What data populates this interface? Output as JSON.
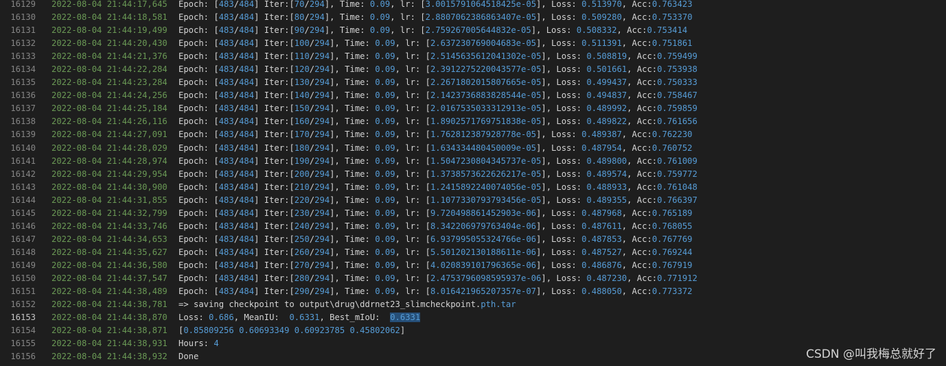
{
  "log": {
    "lines": [
      {
        "n": "16129",
        "ts": "2022-08-04 21:44:17,645",
        "msg": "Epoch: [483/484] Iter:[70/294], Time: 0.09, lr: [3.0015791064518425e-05], Loss: 0.513970, Acc:0.763423"
      },
      {
        "n": "16130",
        "ts": "2022-08-04 21:44:18,581",
        "msg": "Epoch: [483/484] Iter:[80/294], Time: 0.09, lr: [2.8807062386863407e-05], Loss: 0.509280, Acc:0.753370"
      },
      {
        "n": "16131",
        "ts": "2022-08-04 21:44:19,499",
        "msg": "Epoch: [483/484] Iter:[90/294], Time: 0.09, lr: [2.759267005644832e-05], Loss: 0.508332, Acc:0.753414"
      },
      {
        "n": "16132",
        "ts": "2022-08-04 21:44:20,430",
        "msg": "Epoch: [483/484] Iter:[100/294], Time: 0.09, lr: [2.637230769004683e-05], Loss: 0.511391, Acc:0.751861"
      },
      {
        "n": "16133",
        "ts": "2022-08-04 21:44:21,376",
        "msg": "Epoch: [483/484] Iter:[110/294], Time: 0.09, lr: [2.5145635612041302e-05], Loss: 0.508819, Acc:0.759499"
      },
      {
        "n": "16134",
        "ts": "2022-08-04 21:44:22,284",
        "msg": "Epoch: [483/484] Iter:[120/294], Time: 0.09, lr: [2.3912275220043577e-05], Loss: 0.501661, Acc:0.753938"
      },
      {
        "n": "16135",
        "ts": "2022-08-04 21:44:23,284",
        "msg": "Epoch: [483/484] Iter:[130/294], Time: 0.09, lr: [2.2671802015807665e-05], Loss: 0.499437, Acc:0.750333"
      },
      {
        "n": "16136",
        "ts": "2022-08-04 21:44:24,256",
        "msg": "Epoch: [483/484] Iter:[140/294], Time: 0.09, lr: [2.1423736883828544e-05], Loss: 0.494837, Acc:0.758467"
      },
      {
        "n": "16137",
        "ts": "2022-08-04 21:44:25,184",
        "msg": "Epoch: [483/484] Iter:[150/294], Time: 0.09, lr: [2.0167535033312913e-05], Loss: 0.489992, Acc:0.759859"
      },
      {
        "n": "16138",
        "ts": "2022-08-04 21:44:26,116",
        "msg": "Epoch: [483/484] Iter:[160/294], Time: 0.09, lr: [1.8902571769751838e-05], Loss: 0.489822, Acc:0.761656"
      },
      {
        "n": "16139",
        "ts": "2022-08-04 21:44:27,091",
        "msg": "Epoch: [483/484] Iter:[170/294], Time: 0.09, lr: [1.762812387928778e-05], Loss: 0.489387, Acc:0.762230"
      },
      {
        "n": "16140",
        "ts": "2022-08-04 21:44:28,029",
        "msg": "Epoch: [483/484] Iter:[180/294], Time: 0.09, lr: [1.634334480450009e-05], Loss: 0.487954, Acc:0.760752"
      },
      {
        "n": "16141",
        "ts": "2022-08-04 21:44:28,974",
        "msg": "Epoch: [483/484] Iter:[190/294], Time: 0.09, lr: [1.5047230804345737e-05], Loss: 0.489800, Acc:0.761009"
      },
      {
        "n": "16142",
        "ts": "2022-08-04 21:44:29,954",
        "msg": "Epoch: [483/484] Iter:[200/294], Time: 0.09, lr: [1.3738573622626217e-05], Loss: 0.489574, Acc:0.759772"
      },
      {
        "n": "16143",
        "ts": "2022-08-04 21:44:30,900",
        "msg": "Epoch: [483/484] Iter:[210/294], Time: 0.09, lr: [1.2415892240074056e-05], Loss: 0.488933, Acc:0.761048"
      },
      {
        "n": "16144",
        "ts": "2022-08-04 21:44:31,855",
        "msg": "Epoch: [483/484] Iter:[220/294], Time: 0.09, lr: [1.1077330793793456e-05], Loss: 0.489355, Acc:0.766397"
      },
      {
        "n": "16145",
        "ts": "2022-08-04 21:44:32,799",
        "msg": "Epoch: [483/484] Iter:[230/294], Time: 0.09, lr: [9.720498861452903e-06], Loss: 0.487968, Acc:0.765189"
      },
      {
        "n": "16146",
        "ts": "2022-08-04 21:44:33,746",
        "msg": "Epoch: [483/484] Iter:[240/294], Time: 0.09, lr: [8.342206979763404e-06], Loss: 0.487611, Acc:0.768055"
      },
      {
        "n": "16147",
        "ts": "2022-08-04 21:44:34,653",
        "msg": "Epoch: [483/484] Iter:[250/294], Time: 0.09, lr: [6.937995055324766e-06], Loss: 0.487853, Acc:0.767769"
      },
      {
        "n": "16148",
        "ts": "2022-08-04 21:44:35,627",
        "msg": "Epoch: [483/484] Iter:[260/294], Time: 0.09, lr: [5.501202130188611e-06], Loss: 0.487527, Acc:0.769244"
      },
      {
        "n": "16149",
        "ts": "2022-08-04 21:44:36,580",
        "msg": "Epoch: [483/484] Iter:[270/294], Time: 0.09, lr: [4.020839101796365e-06], Loss: 0.486876, Acc:0.767919"
      },
      {
        "n": "16150",
        "ts": "2022-08-04 21:44:37,547",
        "msg": "Epoch: [483/484] Iter:[280/294], Time: 0.09, lr: [2.4753796098595937e-06], Loss: 0.487230, Acc:0.771912"
      },
      {
        "n": "16151",
        "ts": "2022-08-04 21:44:38,489",
        "msg": "Epoch: [483/484] Iter:[290/294], Time: 0.09, lr: [8.016421965207357e-07], Loss: 0.488050, Acc:0.773372"
      },
      {
        "n": "16152",
        "ts": "2022-08-04 21:44:38,781",
        "msg": "=> saving checkpoint to output\\drug\\ddrnet23_slimcheckpoint.pth.tar"
      },
      {
        "n": "16153",
        "ts": "2022-08-04 21:44:38,870",
        "msg": "Loss: 0.686, MeanIU:  0.6331, Best_mIoU:  0.6331",
        "current": true
      },
      {
        "n": "16154",
        "ts": "2022-08-04 21:44:38,871",
        "msg": "[0.85809256 0.60693349 0.60923785 0.45802062]"
      },
      {
        "n": "16155",
        "ts": "2022-08-04 21:44:38,931",
        "msg": "Hours: 4"
      },
      {
        "n": "16156",
        "ts": "2022-08-04 21:44:38,932",
        "msg": "Done"
      }
    ]
  },
  "watermark": "CSDN @叫我梅总就好了",
  "colors": {
    "background": "#1e1e1e",
    "line_number": "#858585",
    "timestamp": "#6a9955",
    "text": "#d4d4d4",
    "number": "#569cd6",
    "selection": "#264f78"
  }
}
